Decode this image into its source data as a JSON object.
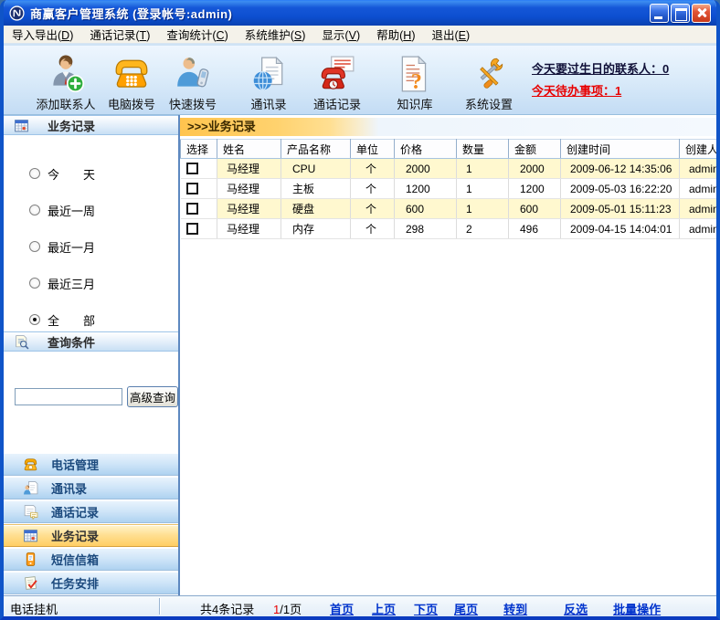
{
  "window": {
    "title": "商赢客户管理系统 (登录帐号:admin)"
  },
  "menu": {
    "items": [
      {
        "text": "导入导出",
        "key": "D"
      },
      {
        "text": "通话记录",
        "key": "T"
      },
      {
        "text": "查询统计",
        "key": "C"
      },
      {
        "text": "系统维护",
        "key": "S"
      },
      {
        "text": "显示",
        "key": "V"
      },
      {
        "text": "帮助",
        "key": "H"
      },
      {
        "text": "退出",
        "key": "E"
      }
    ]
  },
  "toolbar": {
    "buttons": [
      {
        "label": "添加联系人",
        "icon": "add-contact-icon"
      },
      {
        "label": "电脑拨号",
        "icon": "computer-dial-icon"
      },
      {
        "label": "快速拨号",
        "icon": "quick-dial-icon"
      },
      {
        "label": "通讯录",
        "icon": "address-book-icon"
      },
      {
        "label": "通话记录",
        "icon": "call-log-icon"
      },
      {
        "label": "知识库",
        "icon": "knowledge-base-icon"
      },
      {
        "label": "系统设置",
        "icon": "settings-icon"
      }
    ],
    "birthday_link": "今天要过生日的联系人：0",
    "todo_link": "今天待办事项：1"
  },
  "sidebar": {
    "filter_panel": {
      "title": "业务记录"
    },
    "radios": [
      {
        "label": "今　　天",
        "checked": false
      },
      {
        "label": "最近一周",
        "checked": false
      },
      {
        "label": "最近一月",
        "checked": false
      },
      {
        "label": "最近三月",
        "checked": false
      },
      {
        "label": "全　　部",
        "checked": true
      }
    ],
    "query_panel": {
      "title": "查询条件"
    },
    "search": {
      "value": "",
      "button": "高级查询"
    },
    "nav": [
      {
        "label": "电话管理",
        "icon": "phone-icon",
        "active": false
      },
      {
        "label": "通讯录",
        "icon": "contacts-icon",
        "active": false
      },
      {
        "label": "通话记录",
        "icon": "calllog-icon",
        "active": false
      },
      {
        "label": "业务记录",
        "icon": "calendar-icon",
        "active": true
      },
      {
        "label": "短信信箱",
        "icon": "sms-icon",
        "active": false
      },
      {
        "label": "任务安排",
        "icon": "task-icon",
        "active": false
      }
    ]
  },
  "content": {
    "title": ">>>业务记录",
    "table": {
      "columns": [
        "选择",
        "姓名",
        "产品名称",
        "单位",
        "价格",
        "数量",
        "金额",
        "创建时间",
        "创建人"
      ],
      "rows": [
        {
          "name": "马经理",
          "product": "CPU",
          "unit": "个",
          "price": "2000",
          "qty": "1",
          "amount": "2000",
          "created": "2009-06-12 14:35:06",
          "creator": "admin"
        },
        {
          "name": "马经理",
          "product": "主板",
          "unit": "个",
          "price": "1200",
          "qty": "1",
          "amount": "1200",
          "created": "2009-05-03 16:22:20",
          "creator": "admin"
        },
        {
          "name": "马经理",
          "product": "硬盘",
          "unit": "个",
          "price": "600",
          "qty": "1",
          "amount": "600",
          "created": "2009-05-01 15:11:23",
          "creator": "admin"
        },
        {
          "name": "马经理",
          "product": "内存",
          "unit": "个",
          "price": "298",
          "qty": "2",
          "amount": "496",
          "created": "2009-04-15 14:04:01",
          "creator": "admin"
        }
      ]
    }
  },
  "statusbar": {
    "left": "电话挂机",
    "record_count": "共4条记录",
    "page_current": "1",
    "page_total": "/1页",
    "links": [
      "首页",
      "上页",
      "下页",
      "尾页",
      "转到",
      "反选",
      "批量操作"
    ]
  },
  "colors": {
    "titlebar_blue": "#0d4fd0",
    "toolbar_blue": "#d7e9f9",
    "nav_highlight_yellow": "#ffd36e",
    "row_stripe_yellow": "#fff8cf",
    "link_blue": "#0033cc",
    "alert_red": "#e80000"
  }
}
